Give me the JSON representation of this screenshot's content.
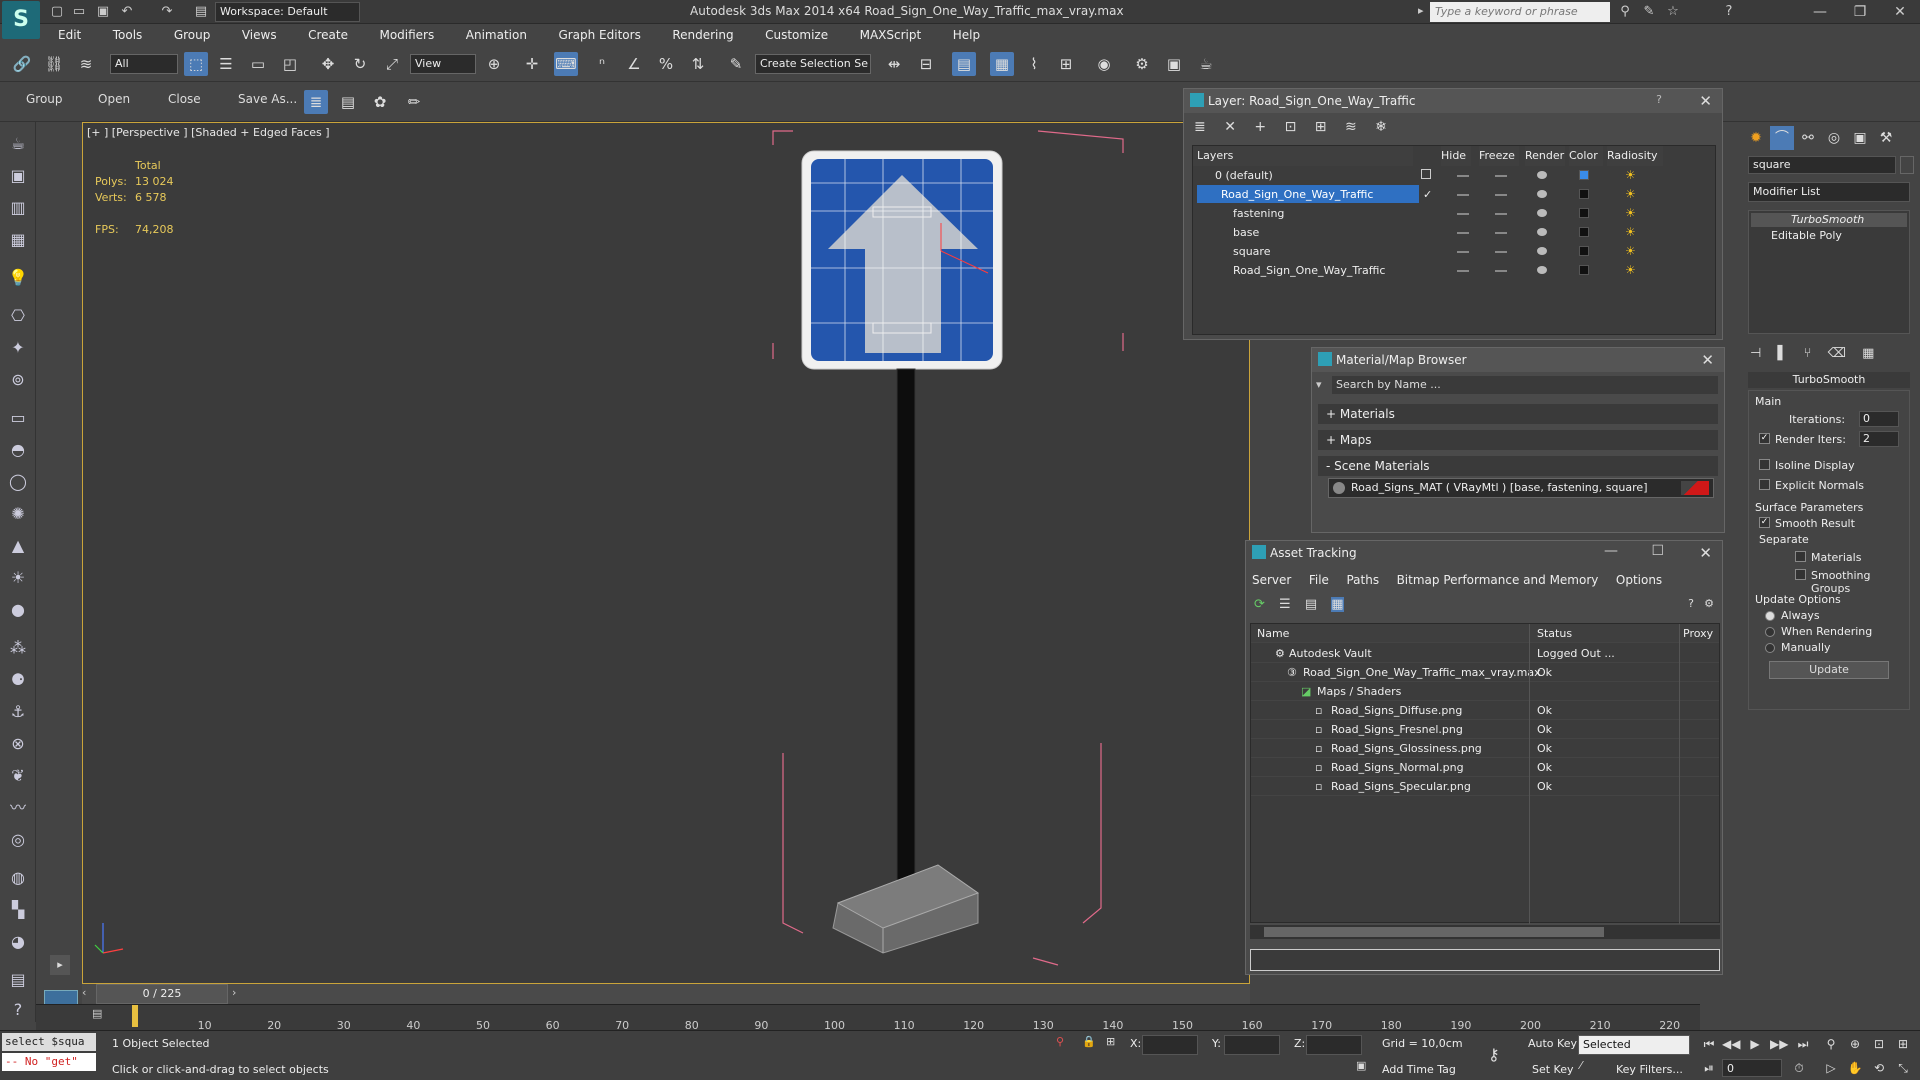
{
  "app": {
    "title": "Autodesk 3ds Max  2014 x64     Road_Sign_One_Way_Traffic_max_vray.max",
    "workspace": "Workspace: Default",
    "search_placeholder": "Type a keyword or phrase"
  },
  "menus": [
    "Edit",
    "Tools",
    "Group",
    "Views",
    "Create",
    "Modifiers",
    "Animation",
    "Graph Editors",
    "Rendering",
    "Customize",
    "MAXScript",
    "Help"
  ],
  "toolbar": {
    "selection_filter": "All",
    "ref_coord": "View",
    "named_selection": "Create Selection Se"
  },
  "subtoolbar": {
    "group": "Group",
    "open": "Open",
    "close": "Close",
    "save_as": "Save As..."
  },
  "viewport": {
    "label": "[+ ] [Perspective ] [Shaded + Edged Faces ]",
    "stats": {
      "total": "Total",
      "polys_label": "Polys:",
      "polys": "13 024",
      "verts_label": "Verts:",
      "verts": "6 578",
      "fps_label": "FPS:",
      "fps": "74,208"
    }
  },
  "layer_window": {
    "title": "Layer: Road_Sign_One_Way_Traffic",
    "headers": [
      "Layers",
      "Hide",
      "Freeze",
      "Render",
      "Color",
      "Radiosity"
    ],
    "rows": [
      {
        "name": "0 (default)",
        "color": "#3a8ce8"
      },
      {
        "name": "Road_Sign_One_Way_Traffic",
        "color": "#111111"
      },
      {
        "name": "fastening",
        "color": "#111111"
      },
      {
        "name": "base",
        "color": "#111111"
      },
      {
        "name": "square",
        "color": "#111111"
      },
      {
        "name": "Road_Sign_One_Way_Traffic",
        "color": "#111111"
      }
    ]
  },
  "material_browser": {
    "title": "Material/Map Browser",
    "search": "Search by Name ...",
    "sections": [
      "+ Materials",
      "+ Maps",
      "- Scene Materials"
    ],
    "scene_material": "Road_Signs_MAT  ( VRayMtl ) [base, fastening, square]"
  },
  "asset_tracking": {
    "title": "Asset Tracking",
    "menus": [
      "Server",
      "File",
      "Paths",
      "Bitmap Performance and Memory",
      "Options"
    ],
    "headers": [
      "Name",
      "Status",
      "Proxy"
    ],
    "rows": [
      {
        "name": "Autodesk Vault",
        "status": "Logged Out ..."
      },
      {
        "name": "Road_Sign_One_Way_Traffic_max_vray.max",
        "status": "Ok"
      },
      {
        "name": "Maps / Shaders",
        "status": ""
      },
      {
        "name": "Road_Signs_Diffuse.png",
        "status": "Ok"
      },
      {
        "name": "Road_Signs_Fresnel.png",
        "status": "Ok"
      },
      {
        "name": "Road_Signs_Glossiness.png",
        "status": "Ok"
      },
      {
        "name": "Road_Signs_Normal.png",
        "status": "Ok"
      },
      {
        "name": "Road_Signs_Specular.png",
        "status": "Ok"
      }
    ]
  },
  "command_panel": {
    "object_name": "square",
    "modifier_list": "Modifier List",
    "stack": [
      "TurboSmooth",
      "Editable Poly"
    ],
    "rollout_title": "TurboSmooth",
    "main": "Main",
    "iterations_label": "Iterations:",
    "iterations": "0",
    "render_iters_label": "Render Iters:",
    "render_iters": "2",
    "isoline": "Isoline Display",
    "explicit_normals": "Explicit Normals",
    "surface_params": "Surface Parameters",
    "smooth_result": "Smooth Result",
    "separate": "Separate",
    "materials": "Materials",
    "smoothing_groups": "Smoothing Groups",
    "update_options": "Update Options",
    "always": "Always",
    "when_rendering": "When Rendering",
    "manually": "Manually",
    "update": "Update"
  },
  "timeline": {
    "frame": "0 / 225",
    "ticks": [
      "10",
      "20",
      "30",
      "40",
      "50",
      "60",
      "70",
      "80",
      "90",
      "100",
      "110",
      "120",
      "130",
      "140",
      "150",
      "160",
      "170",
      "180",
      "190",
      "200",
      "210",
      "220"
    ]
  },
  "status": {
    "script_line1": "select $squa",
    "script_line2": "-- No \"get\"",
    "selected": "1 Object Selected",
    "prompt": "Click or click-and-drag to select objects",
    "x_label": "X:",
    "y_label": "Y:",
    "z_label": "Z:",
    "grid": "Grid = 10,0cm",
    "add_time_tag": "Add Time Tag",
    "auto_key": "Auto Key",
    "set_key": "Set Key",
    "key_mode": "Selected",
    "key_filters": "Key Filters...",
    "frame_field": "0"
  }
}
